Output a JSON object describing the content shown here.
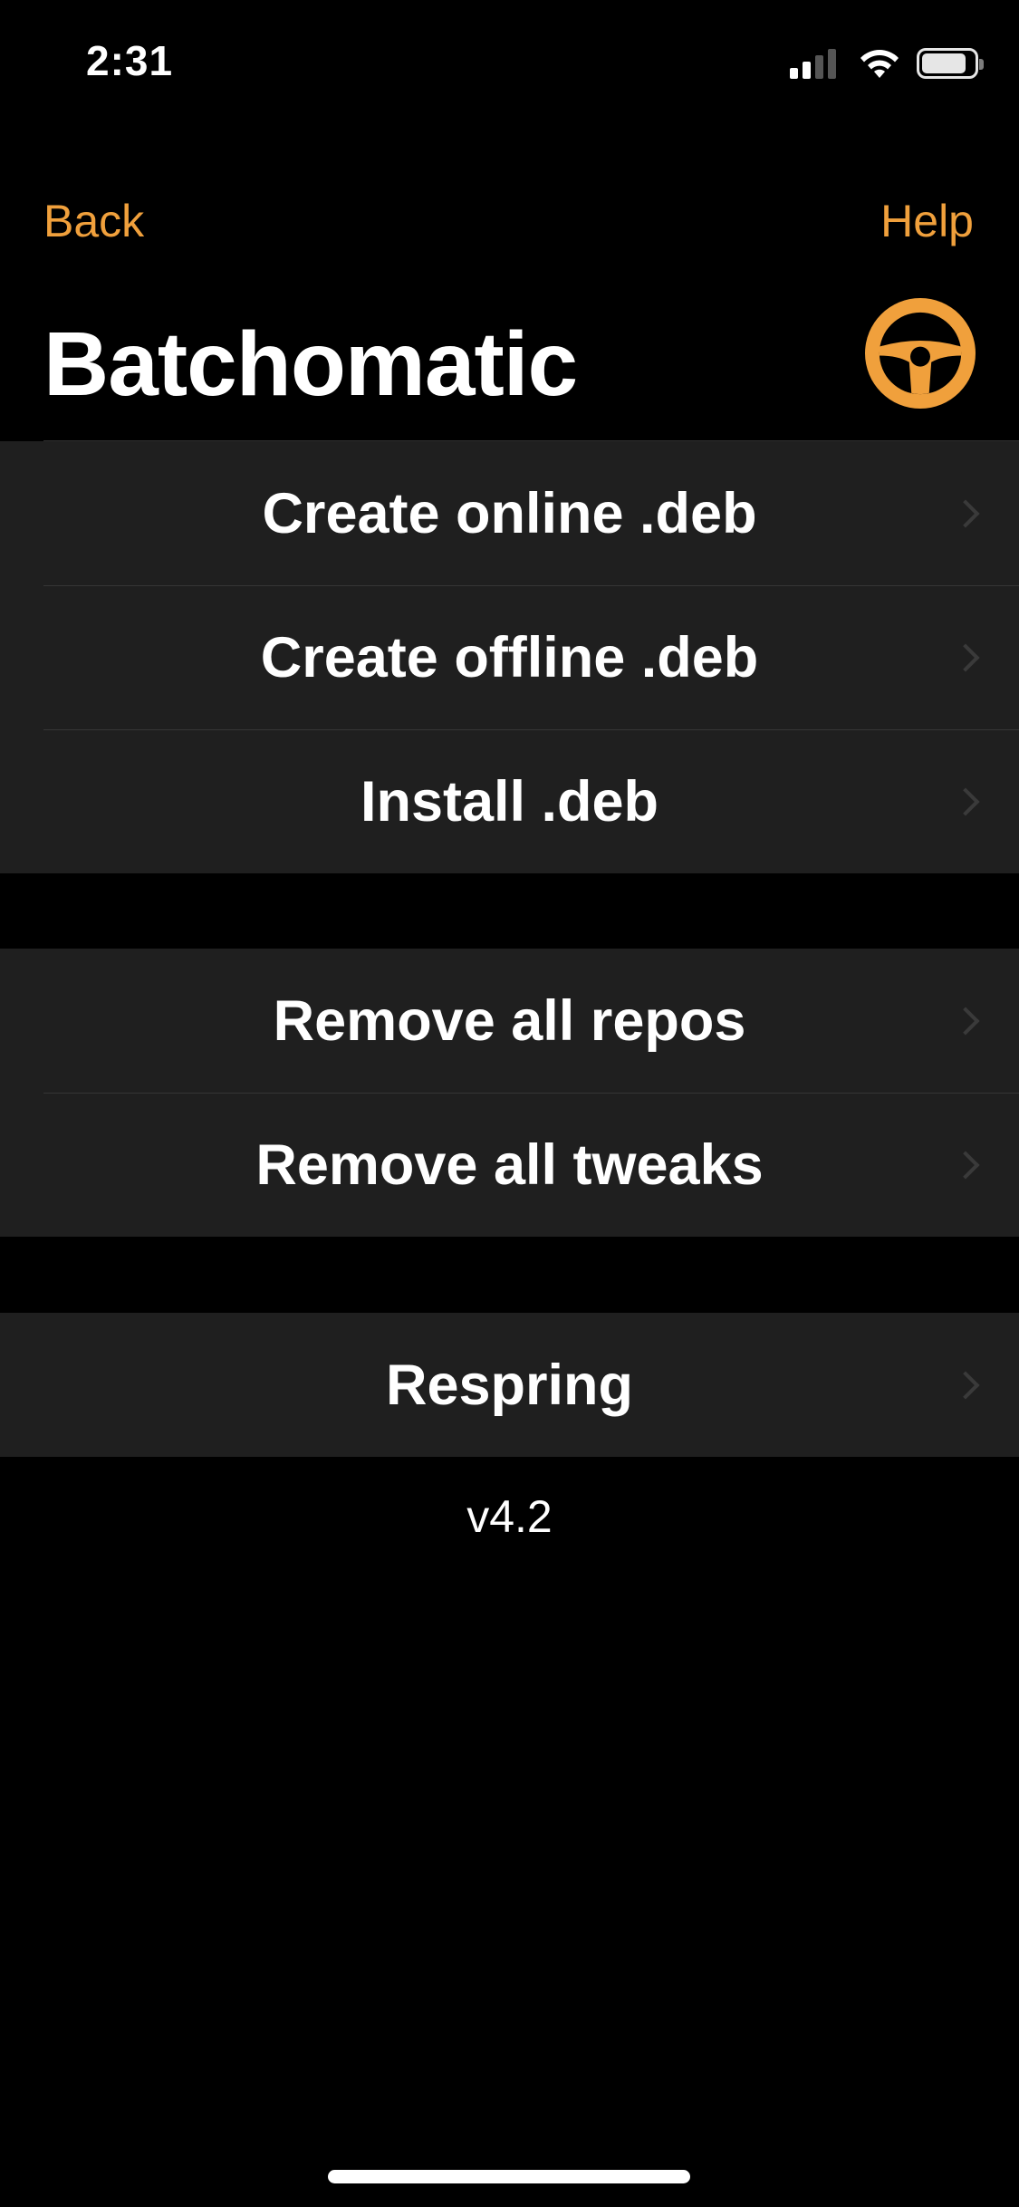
{
  "status_bar": {
    "time": "2:31",
    "signal_bars_active": 2,
    "signal_bars_total": 4,
    "battery_level": 0.85
  },
  "nav": {
    "back_label": "Back",
    "help_label": "Help"
  },
  "title": "Batchomatic",
  "title_icon": "steering-wheel-icon",
  "sections": [
    {
      "items": [
        {
          "label": "Create online .deb"
        },
        {
          "label": "Create offline .deb"
        },
        {
          "label": "Install .deb"
        }
      ]
    },
    {
      "items": [
        {
          "label": "Remove all repos"
        },
        {
          "label": "Remove all tweaks"
        }
      ]
    },
    {
      "items": [
        {
          "label": "Respring"
        }
      ]
    }
  ],
  "version": "v4.2",
  "colors": {
    "accent": "#F0A03C",
    "background": "#000000",
    "cell_background": "#1F1F1F",
    "separator": "#363636",
    "text": "#FFFFFF"
  }
}
